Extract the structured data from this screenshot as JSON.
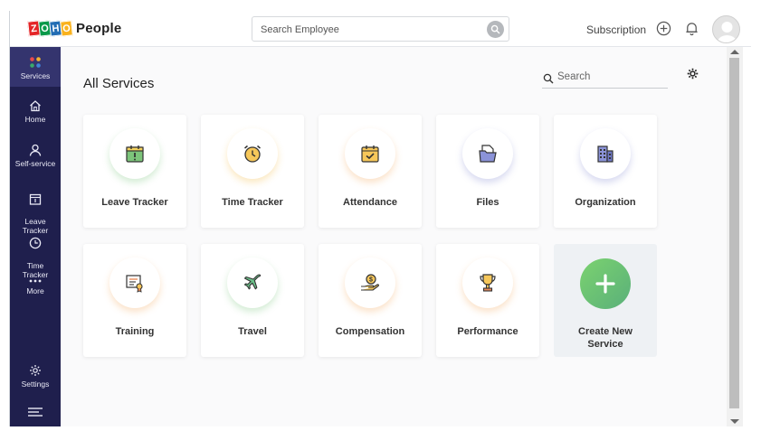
{
  "app": {
    "logo_letters": [
      "Z",
      "O",
      "H",
      "O"
    ],
    "logo_colors": [
      "#e42527",
      "#089949",
      "#226db4",
      "#f9b21d"
    ],
    "name": "People"
  },
  "header": {
    "search_placeholder": "Search Employee",
    "subscription_label": "Subscription"
  },
  "sidebar": {
    "items": [
      {
        "label": "Services",
        "icon": "services-dots-icon"
      },
      {
        "label": "Home",
        "icon": "home-icon"
      },
      {
        "label": "Self-service",
        "icon": "user-icon"
      },
      {
        "label": "Leave\nTracker",
        "icon": "calendar-icon"
      },
      {
        "label": "Time\nTracker",
        "icon": "clock-icon"
      },
      {
        "label": "More",
        "icon": "more-dots-icon"
      },
      {
        "label": "Settings",
        "icon": "gear-icon"
      }
    ]
  },
  "main": {
    "title": "All Services",
    "search_placeholder": "Search",
    "services": [
      {
        "label": "Leave Tracker",
        "icon": "leave-tracker-icon"
      },
      {
        "label": "Time Tracker",
        "icon": "alarm-clock-icon"
      },
      {
        "label": "Attendance",
        "icon": "attendance-icon"
      },
      {
        "label": "Files",
        "icon": "files-icon"
      },
      {
        "label": "Organization",
        "icon": "organization-icon"
      },
      {
        "label": "Training",
        "icon": "training-icon"
      },
      {
        "label": "Travel",
        "icon": "airplane-icon"
      },
      {
        "label": "Compensation",
        "icon": "compensation-icon"
      },
      {
        "label": "Performance",
        "icon": "trophy-icon"
      }
    ],
    "create_new_label": "Create New\nService"
  },
  "colors": {
    "sidebar_bg": "#1f1f4d",
    "accent_green": "#6cc170"
  }
}
